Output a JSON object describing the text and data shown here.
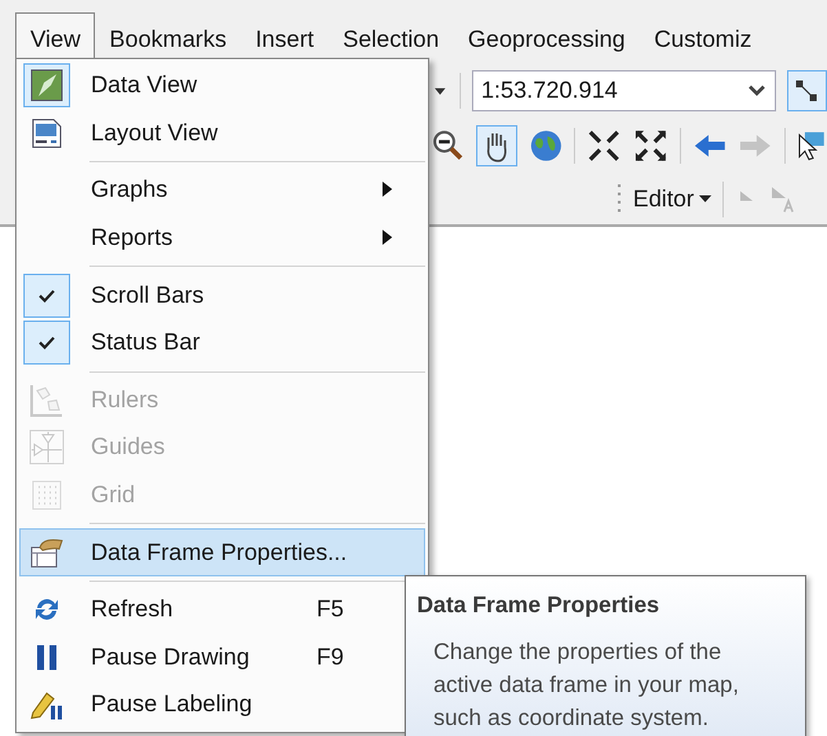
{
  "menubar": [
    {
      "label": "View",
      "selected": true
    },
    {
      "label": "Bookmarks",
      "selected": false
    },
    {
      "label": "Insert",
      "selected": false
    },
    {
      "label": "Selection",
      "selected": false
    },
    {
      "label": "Geoprocessing",
      "selected": false
    },
    {
      "label": "Customiz",
      "selected": false
    }
  ],
  "toolbar": {
    "scale": "1:53.720.914",
    "editor": "Editor"
  },
  "menu": {
    "items": [
      {
        "kind": "item",
        "label": "Data View",
        "checked": true,
        "disabled": false,
        "selected": false,
        "submenu": false
      },
      {
        "kind": "item",
        "label": "Layout View",
        "checked": false,
        "disabled": false,
        "selected": false,
        "submenu": false
      },
      {
        "kind": "separator"
      },
      {
        "kind": "item",
        "label": "Graphs",
        "checked": false,
        "disabled": false,
        "selected": false,
        "submenu": true
      },
      {
        "kind": "item",
        "label": "Reports",
        "checked": false,
        "disabled": false,
        "selected": false,
        "submenu": true
      },
      {
        "kind": "separator"
      },
      {
        "kind": "item",
        "label": "Scroll Bars",
        "checked": true,
        "disabled": false,
        "selected": false,
        "submenu": false
      },
      {
        "kind": "item",
        "label": "Status Bar",
        "checked": true,
        "disabled": false,
        "selected": false,
        "submenu": false
      },
      {
        "kind": "separator"
      },
      {
        "kind": "item",
        "label": "Rulers",
        "checked": false,
        "disabled": true,
        "selected": false,
        "submenu": false
      },
      {
        "kind": "item",
        "label": "Guides",
        "checked": false,
        "disabled": true,
        "selected": false,
        "submenu": false
      },
      {
        "kind": "item",
        "label": "Grid",
        "checked": false,
        "disabled": true,
        "selected": false,
        "submenu": false
      },
      {
        "kind": "separator"
      },
      {
        "kind": "item",
        "label": "Data Frame Properties...",
        "checked": false,
        "disabled": false,
        "selected": true,
        "submenu": false
      },
      {
        "kind": "separator"
      },
      {
        "kind": "item",
        "label": "Refresh",
        "shortcut": "F5",
        "checked": false,
        "disabled": false,
        "selected": false,
        "submenu": false
      },
      {
        "kind": "item",
        "label": "Pause Drawing",
        "shortcut": "F9",
        "checked": false,
        "disabled": false,
        "selected": false,
        "submenu": false
      },
      {
        "kind": "item",
        "label": "Pause Labeling",
        "checked": false,
        "disabled": false,
        "selected": false,
        "submenu": false
      }
    ]
  },
  "tooltip": {
    "title": "Data Frame Properties",
    "body": "Change the properties of the active data frame in your map, such as coordinate system."
  }
}
